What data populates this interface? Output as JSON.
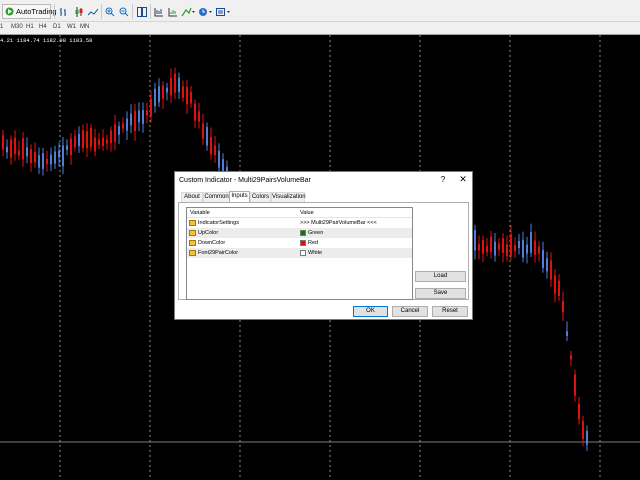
{
  "toolbar": {
    "autotrading_label": "AutoTrading",
    "buttons": [
      "bar-chart-icon",
      "candlestick-icon",
      "line-chart-icon",
      "zoom-in-icon",
      "zoom-out-icon",
      "tile-windows-icon",
      "chart-shift-icon",
      "indicators-icon",
      "clock-icon",
      "templates-icon"
    ]
  },
  "periods": [
    "1",
    "M30",
    "H1",
    "H4",
    "D1",
    "W1",
    "MN"
  ],
  "chart": {
    "ohlc_text": "4.21 1184.74 1182.98 1183.58",
    "colors": {
      "background": "#000000",
      "up": "#4f7fd7",
      "down": "#e0120e",
      "grid": "#ffffff"
    }
  },
  "dialog": {
    "title": "Custom Indicator - Multi29PairsVolumeBar",
    "help": "?",
    "close": "✕",
    "tabs": [
      "About",
      "Common",
      "Inputs",
      "Colors",
      "Visualization"
    ],
    "active_tab": "Inputs",
    "grid": {
      "headers": {
        "variable": "Variable",
        "value": "Value"
      },
      "rows": [
        {
          "name": "IndicatorSettings",
          "value": ">>> Multi29PairVolumeBar <<<",
          "color": null
        },
        {
          "name": "UpColor",
          "value": "Green",
          "color": "#008000"
        },
        {
          "name": "DownColor",
          "value": "Red",
          "color": "#ff0000"
        },
        {
          "name": "Font29PairColor",
          "value": "White",
          "color": "#ffffff"
        }
      ]
    },
    "buttons": {
      "load": "Load",
      "save": "Save",
      "ok": "OK",
      "cancel": "Cancel",
      "reset": "Reset"
    }
  }
}
